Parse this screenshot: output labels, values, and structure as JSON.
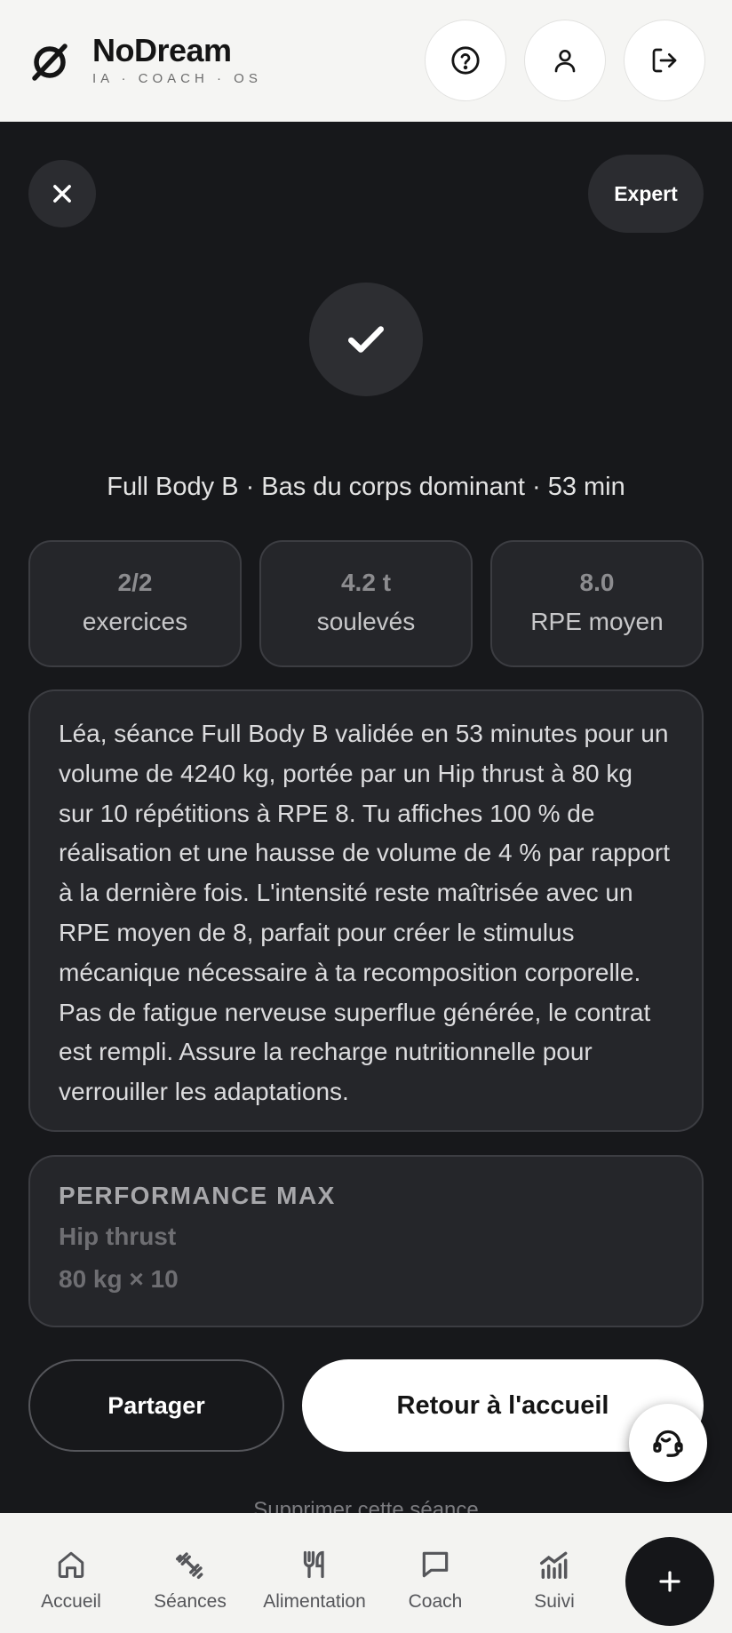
{
  "header": {
    "brand_name": "NoDream",
    "brand_tagline": "IA · COACH · OS",
    "icons": [
      "help-icon",
      "user-icon",
      "logout-icon"
    ]
  },
  "top": {
    "expert_label": "Expert"
  },
  "session": {
    "summary": "Full Body B · Bas du corps dominant · 53 min",
    "stats": [
      {
        "value": "2/2",
        "label": "exercices"
      },
      {
        "value": "4.2 t",
        "label": "soulevés"
      },
      {
        "value": "8.0",
        "label": "RPE moyen"
      }
    ],
    "coach_message": "Léa, séance Full Body B validée en 53 minutes pour un volume de 4240 kg, portée par un Hip thrust à 80 kg sur 10 répétitions à RPE 8. Tu affiches 100 % de réalisation et une hausse de volume de 4 % par rapport à la dernière fois. L'intensité reste maîtrisée avec un RPE moyen de 8, parfait pour créer le stimulus mécanique nécessaire à ta recomposition corporelle. Pas de fatigue nerveuse superflue générée, le contrat est rempli. Assure la recharge nutritionnelle pour verrouiller les adaptations."
  },
  "performance": {
    "title": "PERFORMANCE MAX",
    "exercise": "Hip thrust",
    "value": "80 kg × 10"
  },
  "actions": {
    "share_label": "Partager",
    "home_label": "Retour à l'accueil",
    "delete_label": "Supprimer cette séance"
  },
  "nav": {
    "items": [
      {
        "label": "Accueil",
        "icon": "home-icon"
      },
      {
        "label": "Séances",
        "icon": "dumbbell-icon"
      },
      {
        "label": "Alimentation",
        "icon": "fork-knife-icon"
      },
      {
        "label": "Coach",
        "icon": "chat-icon"
      },
      {
        "label": "Suivi",
        "icon": "chart-icon"
      }
    ]
  },
  "colors": {
    "background": "#17181b",
    "card": "#25262a",
    "header": "#f5f5f3",
    "accent": "#ffffff"
  }
}
